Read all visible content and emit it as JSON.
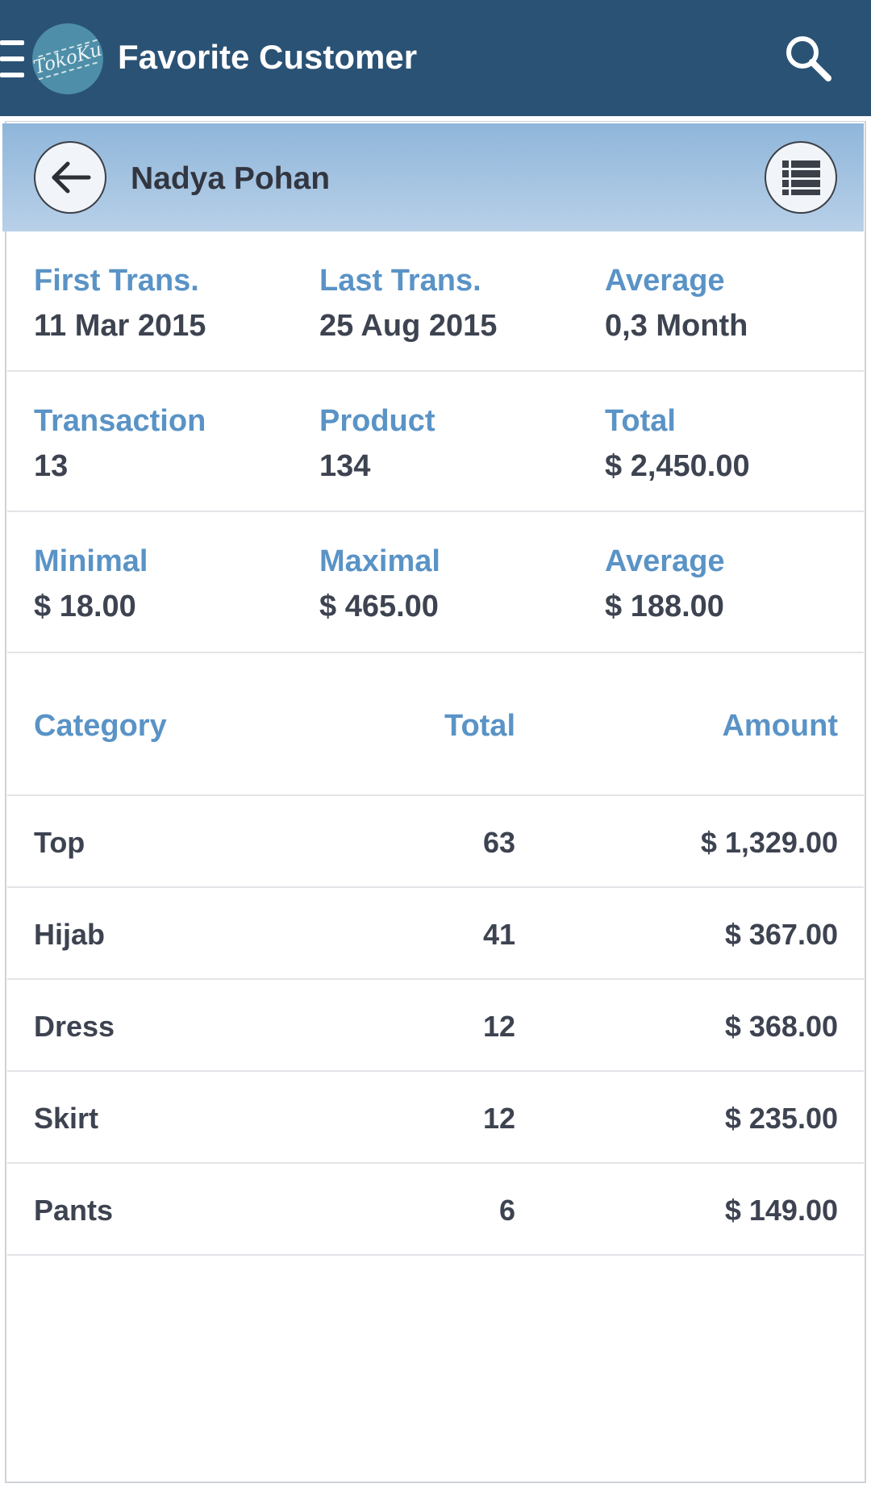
{
  "app": {
    "title": "Favorite Customer",
    "logo_text": "TokoKu"
  },
  "customer": {
    "name": "Nadya Pohan"
  },
  "stats": [
    {
      "label": "First Trans.",
      "value": "11 Mar 2015"
    },
    {
      "label": "Last Trans.",
      "value": "25 Aug 2015"
    },
    {
      "label": "Average",
      "value": "0,3 Month"
    },
    {
      "label": "Transaction",
      "value": "13"
    },
    {
      "label": "Product",
      "value": "134"
    },
    {
      "label": "Total",
      "value": "$ 2,450.00"
    },
    {
      "label": "Minimal",
      "value": "$ 18.00"
    },
    {
      "label": "Maximal",
      "value": "$ 465.00"
    },
    {
      "label": "Average",
      "value": "$ 188.00"
    }
  ],
  "table": {
    "headers": {
      "category": "Category",
      "total": "Total",
      "amount": "Amount"
    },
    "rows": [
      {
        "category": "Top",
        "total": "63",
        "amount": "$ 1,329.00"
      },
      {
        "category": "Hijab",
        "total": "41",
        "amount": "$ 367.00"
      },
      {
        "category": "Dress",
        "total": "12",
        "amount": "$ 368.00"
      },
      {
        "category": "Skirt",
        "total": "12",
        "amount": "$ 235.00"
      },
      {
        "category": "Pants",
        "total": "6",
        "amount": "$ 149.00"
      }
    ]
  },
  "icons": {
    "menu": "menu-icon",
    "search": "search-icon",
    "back": "arrow-left-icon",
    "list": "list-icon"
  },
  "colors": {
    "app_bar": "#2a5275",
    "accent_label": "#5a93c6",
    "header_band_top": "#8fb6da",
    "header_band_bottom": "#b8d0e8"
  }
}
